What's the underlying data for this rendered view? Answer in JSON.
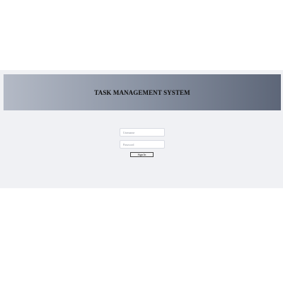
{
  "header": {
    "title": "TASK MANAGEMENT SYSTEM"
  },
  "login": {
    "username_placeholder": "Username",
    "username_value": "",
    "password_placeholder": "Password",
    "password_value": "",
    "signin_label": "Sign In"
  },
  "colors": {
    "page_background": "#ffffff",
    "panel_background": "#f0f1f4",
    "banner_gradient_start": "#b4bac6",
    "banner_gradient_end": "#5d6678",
    "title_color": "#111111"
  }
}
